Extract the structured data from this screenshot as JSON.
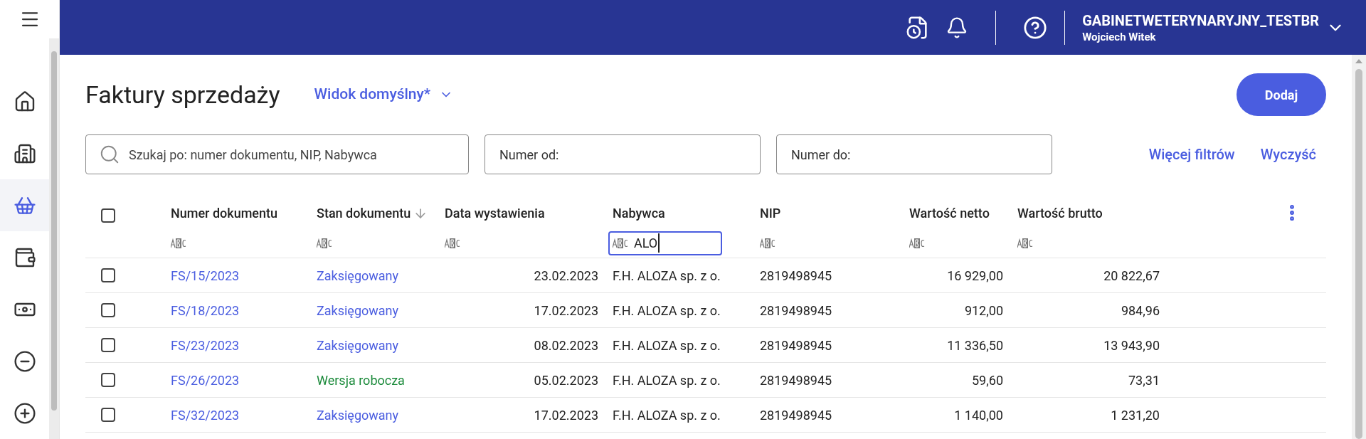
{
  "header": {
    "company": "GABINETWETERYNARYJNY_TESTBR",
    "user": "Wojciech Witek"
  },
  "sidebar": {
    "items": [
      {
        "selected": false
      },
      {
        "selected": false
      },
      {
        "selected": true
      },
      {
        "selected": false
      },
      {
        "selected": false
      },
      {
        "selected": false
      },
      {
        "selected": false
      }
    ]
  },
  "page": {
    "title": "Faktury sprzedaży",
    "view": "Widok domyślny*",
    "add_button": "Dodaj"
  },
  "filters": {
    "search_placeholder": "Szukaj po: numer dokumentu, NIP, Nabywca",
    "from_placeholder": "Numer od:",
    "to_placeholder": "Numer do:",
    "more": "Więcej filtrów",
    "clear": "Wyczyść"
  },
  "table": {
    "select_all_checked": false,
    "columns": [
      {
        "label": "Numer dokumentu",
        "sorted": false,
        "filter": {
          "focused": false
        }
      },
      {
        "label": "Stan dokumentu",
        "sorted": true,
        "filter": {
          "focused": false
        }
      },
      {
        "label": "Data wystawienia",
        "sorted": false,
        "filter": {
          "focused": false
        }
      },
      {
        "label": "Nabywca",
        "sorted": false,
        "filter": {
          "value": "ALO",
          "focused": true
        }
      },
      {
        "label": "NIP",
        "sorted": false,
        "filter": {
          "focused": false
        }
      },
      {
        "label": "Wartość netto",
        "sorted": false,
        "filter": {
          "focused": false
        }
      },
      {
        "label": "Wartość brutto",
        "sorted": false,
        "filter": {
          "focused": false
        }
      }
    ],
    "rows": [
      {
        "checked": false,
        "number": "FS/15/2023",
        "status": "Zaksięgowany",
        "color": "#4a5de0",
        "date": "23.02.2023",
        "buyer": "F.H. ALOZA sp. z o.",
        "nip": "2819498945",
        "net": "16 929,00",
        "gross": "20 822,67"
      },
      {
        "checked": false,
        "number": "FS/18/2023",
        "status": "Zaksięgowany",
        "color": "#4a5de0",
        "date": "17.02.2023",
        "buyer": "F.H. ALOZA sp. z o.",
        "nip": "2819498945",
        "net": "912,00",
        "gross": "984,96"
      },
      {
        "checked": false,
        "number": "FS/23/2023",
        "status": "Zaksięgowany",
        "color": "#4a5de0",
        "date": "08.02.2023",
        "buyer": "F.H. ALOZA sp. z o.",
        "nip": "2819498945",
        "net": "11 336,50",
        "gross": "13 943,90"
      },
      {
        "checked": false,
        "number": "FS/26/2023",
        "status": "Wersja robocza",
        "color": "#1a8a3a",
        "date": "05.02.2023",
        "buyer": "F.H. ALOZA sp. z o.",
        "nip": "2819498945",
        "net": "59,60",
        "gross": "73,31"
      },
      {
        "checked": false,
        "number": "FS/32/2023",
        "status": "Zaksięgowany",
        "color": "#4a5de0",
        "date": "17.02.2023",
        "buyer": "F.H. ALOZA sp. z o.",
        "nip": "2819498945",
        "net": "1 140,00",
        "gross": "1 231,20"
      }
    ]
  }
}
